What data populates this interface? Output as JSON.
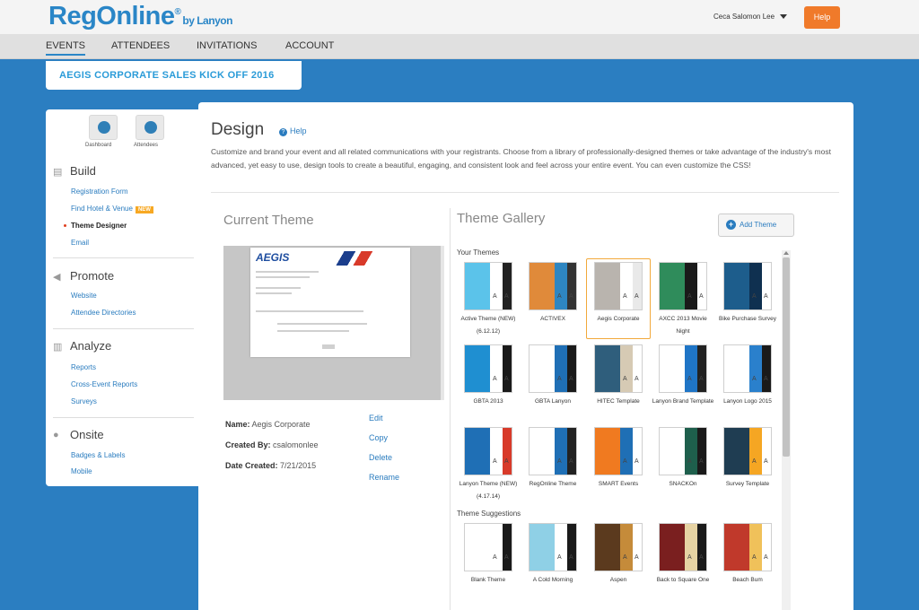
{
  "header": {
    "logo": "RegOnline",
    "logo_mark": "®",
    "logo_by": "by Lanyon",
    "user": "Ceca Salomon Lee",
    "help": "Help"
  },
  "nav": [
    {
      "label": "EVENTS"
    },
    {
      "label": "ATTENDEES"
    },
    {
      "label": "INVITATIONS"
    },
    {
      "label": "ACCOUNT"
    }
  ],
  "event_name": "AEGIS CORPORATE SALES KICK OFF 2016",
  "sidebar": {
    "quick": [
      {
        "label": "Dashboard"
      },
      {
        "label": "Attendees"
      }
    ],
    "sections": [
      {
        "title": "Build",
        "links": [
          {
            "label": "Registration Form"
          },
          {
            "label": "Find Hotel & Venue",
            "badge": "NEW"
          },
          {
            "label": "Theme Designer"
          },
          {
            "label": "Email"
          }
        ]
      },
      {
        "title": "Promote",
        "links": [
          {
            "label": "Website"
          },
          {
            "label": "Attendee Directories"
          }
        ]
      },
      {
        "title": "Analyze",
        "links": [
          {
            "label": "Reports"
          },
          {
            "label": "Cross-Event Reports"
          },
          {
            "label": "Surveys"
          }
        ]
      },
      {
        "title": "Onsite",
        "links": [
          {
            "label": "Badges & Labels"
          },
          {
            "label": "Mobile"
          }
        ]
      }
    ]
  },
  "main": {
    "title": "Design",
    "help": "Help",
    "intro": "Customize and brand your event and all related communications with your registrants. Choose from a library of professionally-designed themes or take advantage of the industry's most advanced, yet easy to use, design tools to create a beautiful, engaging, and consistent look and feel across your entire event. You can even customize the CSS!",
    "current": {
      "title": "Current Theme",
      "preview_brand": "AEGIS",
      "name_label": "Name:",
      "name": "Aegis Corporate",
      "created_by_label": "Created By:",
      "created_by": "csalomonlee",
      "date_label": "Date Created:",
      "date": "7/21/2015",
      "actions": [
        {
          "label": "Edit"
        },
        {
          "label": "Copy"
        },
        {
          "label": "Delete"
        },
        {
          "label": "Rename"
        }
      ]
    },
    "gallery": {
      "title": "Theme Gallery",
      "add_button": "Add Theme",
      "your_themes_label": "Your Themes",
      "suggestions_label": "Theme Suggestions",
      "your_themes": [
        {
          "name": "Active Theme (NEW) (6.12.12)",
          "colors": [
            "#5bc3ea",
            "#ffffff",
            "#222222"
          ]
        },
        {
          "name": "ACTIVEX",
          "colors": [
            "#e08a3a",
            "#2e86c1",
            "#333333"
          ]
        },
        {
          "name": "Aegis Corporate",
          "colors": [
            "#b9b4ae",
            "#ffffff",
            "#e9e9e9"
          ]
        },
        {
          "name": "AXCC 2013 Movie Night",
          "colors": [
            "#2f8c5b",
            "#1a1a1a",
            "#ffffff"
          ]
        },
        {
          "name": "Bike Purchase Survey",
          "colors": [
            "#1d5d8c",
            "#0f3050",
            "#ffffff"
          ]
        },
        {
          "name": "GBTA 2013",
          "colors": [
            "#1f8fd1",
            "#ffffff",
            "#1a1a1a"
          ]
        },
        {
          "name": "GBTA Lanyon",
          "colors": [
            "#ffffff",
            "#1f6fb5",
            "#1a1a1a"
          ]
        },
        {
          "name": "HITEC Template",
          "colors": [
            "#2f5e7c",
            "#d6cab4",
            "#ffffff"
          ]
        },
        {
          "name": "Lanyon Brand Template",
          "colors": [
            "#ffffff",
            "#1f75c6",
            "#222222"
          ]
        },
        {
          "name": "Lanyon Logo 2015",
          "colors": [
            "#ffffff",
            "#2a80cc",
            "#1a1a1a"
          ]
        },
        {
          "name": "Lanyon Theme (NEW) (4.17.14)",
          "colors": [
            "#1f6fb5",
            "#ffffff",
            "#d83a2a"
          ]
        },
        {
          "name": "RegOnline Theme",
          "colors": [
            "#ffffff",
            "#1f6fb5",
            "#222222"
          ]
        },
        {
          "name": "SMART Events",
          "colors": [
            "#f07a20",
            "#1f6fb5",
            "#ffffff"
          ]
        },
        {
          "name": "SNACKOn",
          "colors": [
            "#ffffff",
            "#1e5f4c",
            "#1a1a1a"
          ]
        },
        {
          "name": "Survey Template",
          "colors": [
            "#1f3d52",
            "#f5a623",
            "#ffffff"
          ]
        }
      ],
      "suggestions": [
        {
          "name": "Blank Theme",
          "colors": [
            "#ffffff",
            "#ffffff",
            "#1a1a1a"
          ]
        },
        {
          "name": "A Cold Morning",
          "colors": [
            "#8fd0e6",
            "#ffffff",
            "#1a1a1a"
          ]
        },
        {
          "name": "Aspen",
          "colors": [
            "#5b3a1e",
            "#c58b3a",
            "#ffffff"
          ]
        },
        {
          "name": "Back to Square One",
          "colors": [
            "#7a1f1f",
            "#e6d3a3",
            "#1a1a1a"
          ]
        },
        {
          "name": "Beach Bum",
          "colors": [
            "#c0392b",
            "#f0c15a",
            "#ffffff"
          ]
        }
      ]
    }
  }
}
